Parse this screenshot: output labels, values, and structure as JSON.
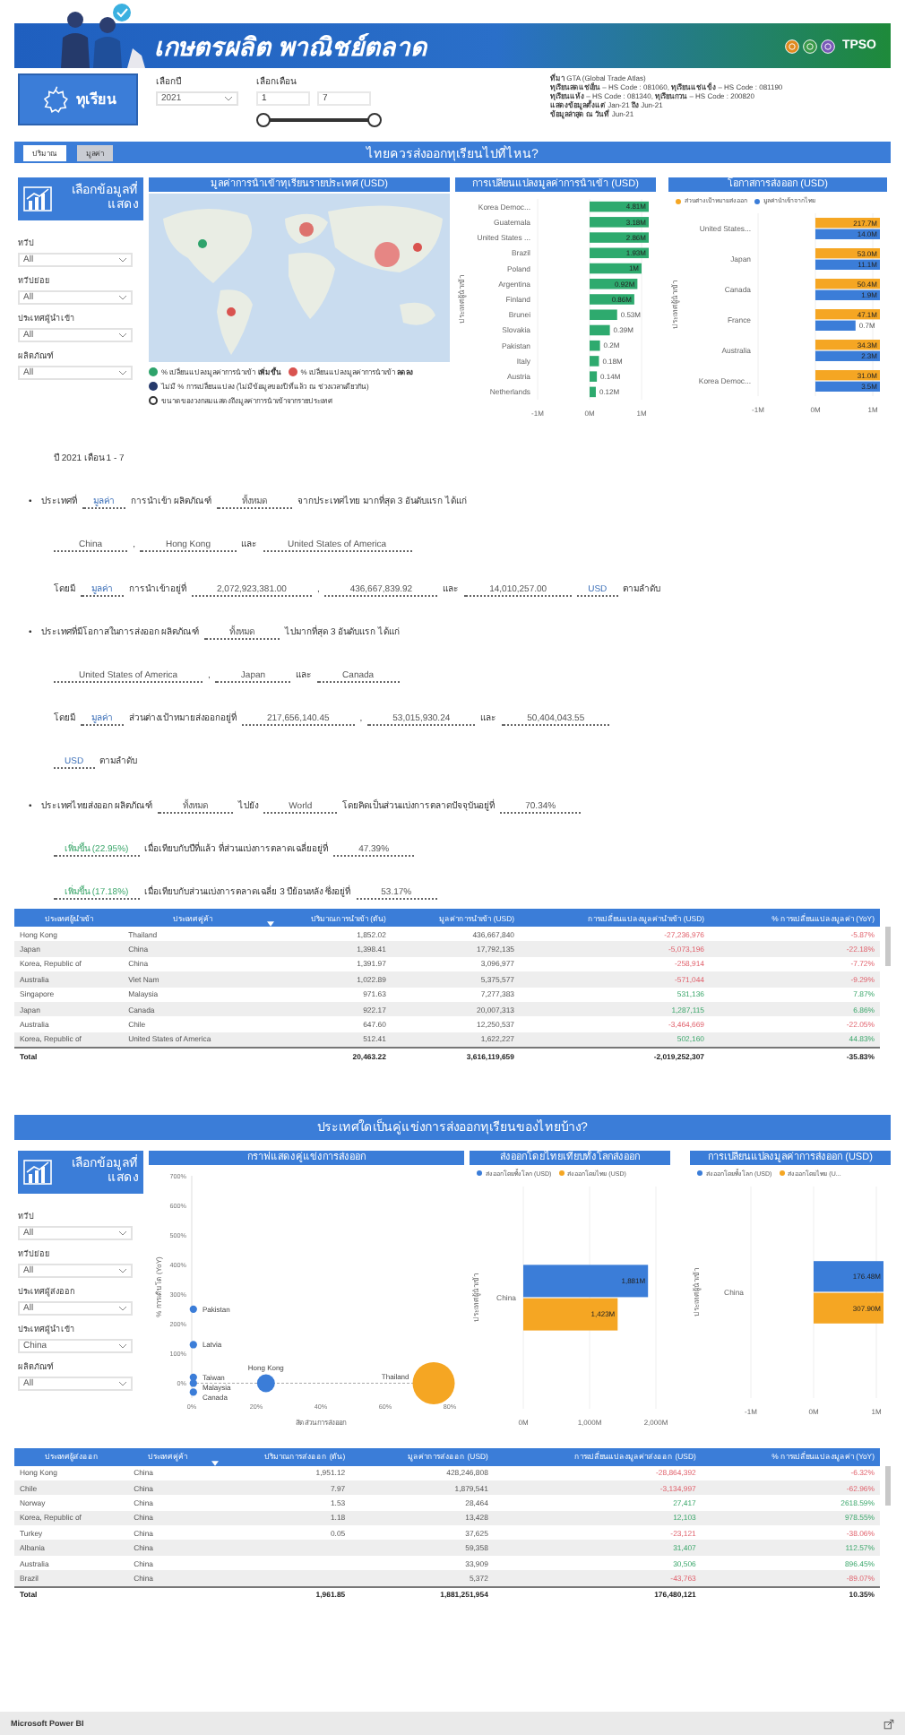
{
  "header": {
    "title": "เกษตรผลิต พาณิชย์ตลาด",
    "brand": "TPSO"
  },
  "product": {
    "label": "ทุเรียน"
  },
  "year_filter": {
    "label": "เลือกปี",
    "value": "2021"
  },
  "month_filter": {
    "label": "เลือกเดือน",
    "from": "1",
    "to": "7",
    "thumbs": [
      {
        "level": 0
      },
      {
        "level": 1
      }
    ]
  },
  "source_notes": [
    "**ที่มา** GTA (Global Trade Atlas)",
    "**ทุเรียนสดแช่เย็น** – HS Code : 081060, **ทุเรียนแช่แข็ง** – HS Code : 081190",
    "**ทุเรียนแห้ง** – HS Code : 081340, **ทุเรียนกวน** – HS Code : 200820",
    "**แสดงข้อมูลตั้งแต่** Jan-21 **ถึง** Jun-21",
    "**ข้อมูลล่าสุด ณ วันที่** Jun-21"
  ],
  "import_section": {
    "toggle": [
      {
        "label": "ปริมาณ",
        "selected": false
      },
      {
        "label": "มูลค่า",
        "selected": true
      }
    ],
    "title": "ไทยควรส่งออกทุเรียนไปที่ไหน?",
    "panel_title": "เลือกข้อมูลที่แสดง",
    "slicers": [
      {
        "label": "ทวีป",
        "value": "All"
      },
      {
        "label": "ทวีปย่อย",
        "value": "All"
      },
      {
        "label": "ประเทศผู้นำเข้า",
        "value": "All"
      },
      {
        "label": "ผลิตภัณฑ์",
        "value": "All"
      }
    ],
    "map": {
      "title": "มูลค่าการนำเข้าทุเรียนรายประเทศ (USD)",
      "legend": [
        {
          "kind": "dot",
          "color": "#2ea36b",
          "text": "% เปลี่ยนแปลงมูลค่าการนำเข้า **เพิ่มขึ้น**"
        },
        {
          "kind": "dot",
          "color": "#d9534f",
          "text": "% เปลี่ยนแปลงมูลค่าการนำเข้า **ลดลง**"
        },
        {
          "kind": "dot",
          "color": "#263a6b",
          "text": "ไม่มี % การเปลี่ยนแปลง (ไม่มีข้อมูลของปีที่แล้ว ณ ช่วงเวลาเดียวกัน)"
        },
        {
          "kind": "ring",
          "text": "ขนาดของวงกลมแสดงถึงมูลค่าการนำเข้าจากรายประเทศ"
        }
      ]
    },
    "change_chart": {
      "title": "การเปลี่ยนแปลงมูลค่าการนำเข้า (USD)",
      "chart_data": {
        "type": "bar",
        "orientation": "horizontal",
        "ylabel": "ประเทศผู้นำเข้า",
        "grid": true,
        "categories": [
          "Korea Democ...",
          "Guatemala",
          "United States ...",
          "Brazil",
          "Poland",
          "Argentina",
          "Finland",
          "Brunei",
          "Slovakia",
          "Pakistan",
          "Italy",
          "Austria",
          "Netherlands"
        ],
        "series": [
          {
            "color": "#2eaa6e",
            "values": [
              null,
              null,
              null,
              null,
              1,
              0.92,
              0.86,
              0.53,
              0.39,
              0.2,
              0.18,
              0.14,
              0.12
            ]
          }
        ],
        "value_labels": [
          [
            "4.81M",
            "3.18M",
            "2.86M",
            "1.93M",
            "1M",
            "0.92M",
            "0.86M",
            "0.53M",
            "0.39M",
            "0.2M",
            "0.18M",
            "0.14M",
            "0.12M"
          ]
        ],
        "xlim": [
          -1,
          1
        ],
        "xticks": [
          {
            "value": -1,
            "label": "-1M"
          },
          {
            "value": 0,
            "label": "0M"
          },
          {
            "value": 1,
            "label": "1M"
          }
        ]
      }
    },
    "opportunity_chart": {
      "title": "โอกาสการส่งออก (USD)",
      "chart_data": {
        "type": "bar",
        "orientation": "horizontal",
        "ylabel": "ประเทศผู้นำเข้า",
        "grid": true,
        "categories": [
          "United States...",
          "Japan",
          "Canada",
          "France",
          "Australia",
          "Korea Democ..."
        ],
        "series": [
          {
            "name": "ส่วนต่างเป้าหมายส่งออก",
            "color": "#f5a623",
            "values": [
              null,
              null,
              null,
              null,
              null,
              null
            ]
          },
          {
            "name": "มูลค่านำเข้าจากไทย",
            "color": "#3b7dd8",
            "values": [
              null,
              null,
              null,
              0.7,
              null,
              null
            ]
          }
        ],
        "value_labels": [
          [
            "217.7M",
            "53.0M",
            "50.4M",
            "47.1M",
            "34.3M",
            "31.0M"
          ],
          [
            "14.0M",
            "11.1M",
            "1.9M",
            "0.7M",
            "2.3M",
            "3.5M"
          ]
        ],
        "xlim": [
          -1,
          1
        ],
        "xticks": [
          {
            "value": -1,
            "label": "-1M"
          },
          {
            "value": 0,
            "label": "0M"
          },
          {
            "value": 1,
            "label": "1M"
          }
        ]
      }
    }
  },
  "summary": {
    "lines": [
      {
        "segments": [
          {
            "kind": "text",
            "text": "ปี 2021 เดือน 1 - 7"
          }
        ]
      },
      {
        "marker": "•",
        "segments": [
          {
            "kind": "text",
            "text": "ประเทศที่"
          },
          {
            "kind": "measure",
            "text": "มูลค่า"
          },
          {
            "kind": "text",
            "text": "การนำเข้า ผลิตภัณฑ์"
          },
          {
            "kind": "blank",
            "text": "ทั้งหมด"
          },
          {
            "kind": "text",
            "text": "จากประเทศไทย มากที่สุด 3 อันดับแรก ได้แก่"
          }
        ]
      },
      {
        "segments": [
          {
            "kind": "blank",
            "text": "China"
          },
          {
            "kind": "text",
            "text": ","
          },
          {
            "kind": "blank",
            "text": "Hong Kong"
          },
          {
            "kind": "text",
            "text": "และ"
          },
          {
            "kind": "blank",
            "text": "United States of America"
          }
        ]
      },
      {
        "segments": [
          {
            "kind": "text",
            "text": "โดยมี"
          },
          {
            "kind": "measure",
            "text": "มูลค่า"
          },
          {
            "kind": "text",
            "text": "การนำเข้าอยู่ที่"
          },
          {
            "kind": "blank",
            "text": "2,072,923,381.00"
          },
          {
            "kind": "text",
            "text": ","
          },
          {
            "kind": "blank",
            "text": "436,667,839.92"
          },
          {
            "kind": "text",
            "text": "และ"
          },
          {
            "kind": "blank",
            "text": "14,010,257.00"
          },
          {
            "kind": "measure",
            "text": "USD"
          },
          {
            "kind": "text",
            "text": "ตามลำดับ"
          }
        ]
      },
      {
        "marker": "•",
        "segments": [
          {
            "kind": "text",
            "text": "ประเทศที่มีโอกาสในการส่งออก ผลิตภัณฑ์"
          },
          {
            "kind": "blank",
            "text": "ทั้งหมด"
          },
          {
            "kind": "text",
            "text": "ไปมากที่สุด 3 อันดับแรก ได้แก่"
          }
        ]
      },
      {
        "segments": [
          {
            "kind": "blank",
            "text": "United States of America"
          },
          {
            "kind": "text",
            "text": ","
          },
          {
            "kind": "blank",
            "text": "Japan"
          },
          {
            "kind": "text",
            "text": "และ"
          },
          {
            "kind": "blank",
            "text": "Canada"
          }
        ]
      },
      {
        "segments": [
          {
            "kind": "text",
            "text": "โดยมี"
          },
          {
            "kind": "measure",
            "text": "มูลค่า"
          },
          {
            "kind": "text",
            "text": "ส่วนต่างเป้าหมายส่งออกอยู่ที่"
          },
          {
            "kind": "blank",
            "text": "217,656,140.45"
          },
          {
            "kind": "text",
            "text": ","
          },
          {
            "kind": "blank",
            "text": "53,015,930.24"
          },
          {
            "kind": "text",
            "text": "และ"
          },
          {
            "kind": "blank",
            "text": "50,404,043.55"
          }
        ]
      },
      {
        "segments": [
          {
            "kind": "measure",
            "text": "USD"
          },
          {
            "kind": "text",
            "text": "ตามลำดับ"
          }
        ]
      },
      {
        "marker": "•",
        "segments": [
          {
            "kind": "text",
            "text": "ประเทศไทยส่งออก ผลิตภัณฑ์"
          },
          {
            "kind": "blank",
            "text": "ทั้งหมด"
          },
          {
            "kind": "text",
            "text": "ไปยัง"
          },
          {
            "kind": "blank",
            "text": "World"
          },
          {
            "kind": "text",
            "text": "โดยคิดเป็นส่วนแบ่งการตลาดปัจจุบันอยู่ที่"
          },
          {
            "kind": "blank",
            "text": "70.34%"
          }
        ]
      },
      {
        "segments": [
          {
            "kind": "increase",
            "text": "เพิ่มขึ้น (22.95%)"
          },
          {
            "kind": "text",
            "text": "เมื่อเทียบกับปีที่แล้ว ที่ส่วนแบ่งการตลาดเฉลี่ยอยู่ที่"
          },
          {
            "kind": "blank",
            "text": "47.39%"
          }
        ]
      },
      {
        "segments": [
          {
            "kind": "increase",
            "text": "เพิ่มขึ้น (17.18%)"
          },
          {
            "kind": "text",
            "text": "เมื่อเทียบกับส่วนแบ่งการตลาดเฉลี่ย 3 ปีย้อนหลัง ซึ่งอยู่ที่"
          },
          {
            "kind": "blank",
            "text": "53.17%"
          }
        ]
      }
    ]
  },
  "import_table": {
    "columns": [
      {
        "label": "ประเทศผู้นำเข้า",
        "sorted": false
      },
      {
        "label": "ประเทศคู่ค้า",
        "sorted": false
      },
      {
        "label": "ปริมาณการนำเข้า (ตัน)",
        "sorted": true
      },
      {
        "label": "มูลค่าการนำเข้า (USD)",
        "sorted": false
      },
      {
        "label": "การเปลี่ยนแปลงมูลค่านำเข้า (USD)",
        "sorted": false
      },
      {
        "label": "% การเปลี่ยนแปลงมูลค่า (YoY)",
        "sorted": false
      }
    ],
    "rows": [
      {
        "country": "Hong Kong",
        "partner": "Thailand",
        "quantity": "1,852.02",
        "value": "436,667,840",
        "change": "-27,236,976",
        "change_pct": "-5.87%",
        "kind": "decrease"
      },
      {
        "country": "Japan",
        "partner": "China",
        "quantity": "1,398.41",
        "value": "17,792,135",
        "change": "-5,073,196",
        "change_pct": "-22.18%",
        "kind": "decrease"
      },
      {
        "country": "Korea, Republic of",
        "partner": "China",
        "quantity": "1,391.97",
        "value": "3,096,977",
        "change": "-258,914",
        "change_pct": "-7.72%",
        "kind": "decrease"
      },
      {
        "country": "Australia",
        "partner": "Viet Nam",
        "quantity": "1,022.89",
        "value": "5,375,577",
        "change": "-571,044",
        "change_pct": "-9.29%",
        "kind": "decrease"
      },
      {
        "country": "Singapore",
        "partner": "Malaysia",
        "quantity": "971.63",
        "value": "7,277,383",
        "change": "531,136",
        "change_pct": "7.87%",
        "kind": "increase"
      },
      {
        "country": "Japan",
        "partner": "Canada",
        "quantity": "922.17",
        "value": "20,007,313",
        "change": "1,287,115",
        "change_pct": "6.86%",
        "kind": "increase"
      },
      {
        "country": "Australia",
        "partner": "Chile",
        "quantity": "647.60",
        "value": "12,250,537",
        "change": "-3,464,669",
        "change_pct": "-22.05%",
        "kind": "decrease"
      },
      {
        "country": "Korea, Republic of",
        "partner": "United States of America",
        "quantity": "512.41",
        "value": "1,622,227",
        "change": "502,160",
        "change_pct": "44.83%",
        "kind": "increase"
      }
    ],
    "total": {
      "label": "Total",
      "quantity": "20,463.22",
      "value": "3,616,119,659",
      "change": "-2,019,252,307",
      "change_pct": "-35.83%"
    }
  },
  "competitor_section": {
    "title": "ประเทศใดเป็นคู่แข่งการส่งออกทุเรียนของไทยบ้าง?",
    "panel_title": "เลือกข้อมูลที่แสดง",
    "slicers": [
      {
        "label": "ทวีป",
        "value": "All"
      },
      {
        "label": "ทวีปย่อย",
        "value": "All"
      },
      {
        "label": "ประเทศผู้ส่งออก",
        "value": "All"
      },
      {
        "label": "ประเทศผู้นำเข้า",
        "value": "China"
      },
      {
        "label": "ผลิตภัณฑ์",
        "value": "All"
      }
    ],
    "scatter": {
      "title": "กราฟแสดงคู่แข่งการส่งออก",
      "chart_data": {
        "type": "scatter",
        "xlabel": "สัดส่วนการส่งออก",
        "ylabel": "% การเติบโต (YoY)",
        "x": [
          0.5,
          0.5,
          0.5,
          0.5,
          0.5,
          23,
          75
        ],
        "series": [
          {
            "name": "Pakistan",
            "color": "#3b7dd8",
            "values": [
              250,
              null,
              null,
              null,
              null,
              null,
              null
            ]
          },
          {
            "name": "Latvia",
            "color": "#3b7dd8",
            "values": [
              null,
              130,
              null,
              null,
              null,
              null,
              null
            ]
          },
          {
            "name": "Taiwan",
            "color": "#3b7dd8",
            "values": [
              null,
              null,
              20,
              null,
              null,
              null,
              null
            ]
          },
          {
            "name": "Malaysia",
            "color": "#3b7dd8",
            "values": [
              null,
              null,
              null,
              0,
              null,
              null,
              null
            ]
          },
          {
            "name": "Canada",
            "color": "#3b7dd8",
            "values": [
              null,
              null,
              null,
              null,
              -30,
              null,
              null
            ]
          },
          {
            "name": "Hong Kong",
            "color": "#3b7dd8",
            "values": [
              null,
              null,
              null,
              null,
              null,
              0,
              null
            ]
          },
          {
            "name": "Thailand",
            "color": "#f5a623",
            "values": [
              null,
              null,
              null,
              null,
              null,
              null,
              0
            ]
          }
        ],
        "xlim": [
          0,
          80
        ],
        "ylim": [
          -50,
          700
        ],
        "xticks": [
          {
            "value": 0,
            "label": "0%"
          },
          {
            "value": 20,
            "label": "20%"
          },
          {
            "value": 40,
            "label": "40%"
          },
          {
            "value": 60,
            "label": "60%"
          },
          {
            "value": 80,
            "label": "80%"
          }
        ],
        "yticks": [
          {
            "value": 0,
            "label": "0%"
          },
          {
            "value": 100,
            "label": "100%"
          },
          {
            "value": 200,
            "label": "200%"
          },
          {
            "value": 300,
            "label": "300%"
          },
          {
            "value": 400,
            "label": "400%"
          },
          {
            "value": 500,
            "label": "500%"
          },
          {
            "value": 600,
            "label": "600%"
          },
          {
            "value": 700,
            "label": "700%"
          }
        ]
      }
    },
    "share_chart": {
      "title": "ส่งออกโดยไทยเทียบทั้งโลกส่งออก",
      "chart_data": {
        "type": "bar",
        "orientation": "horizontal",
        "ylabel": "ประเทศผู้นำเข้า",
        "grid": true,
        "categories": [
          "China"
        ],
        "series": [
          {
            "name": "ส่งออกโดยทั้งโลก (USD)",
            "color": "#3b7dd8",
            "values": [
              1881
            ]
          },
          {
            "name": "ส่งออกโดยไทย (USD)",
            "color": "#f5a623",
            "values": [
              1423
            ]
          }
        ],
        "value_labels": [
          [
            "1,881M"
          ],
          [
            "1,423M"
          ]
        ],
        "xlim": [
          0,
          2000
        ],
        "xticks": [
          {
            "value": 0,
            "label": "0M"
          },
          {
            "value": 1000,
            "label": "1,000M"
          },
          {
            "value": 2000,
            "label": "2,000M"
          }
        ]
      }
    },
    "export_change_chart": {
      "title": "การเปลี่ยนแปลงมูลค่าการส่งออก (USD)",
      "chart_data": {
        "type": "bar",
        "orientation": "horizontal",
        "ylabel": "ประเทศผู้นำเข้า",
        "grid": true,
        "categories": [
          "China"
        ],
        "series": [
          {
            "name": "ส่งออกโดยทั้งโลก (USD)",
            "color": "#3b7dd8",
            "values": [
              null
            ]
          },
          {
            "name": "ส่งออกโดยไทย (U...",
            "color": "#f5a623",
            "values": [
              null
            ]
          }
        ],
        "value_labels": [
          [
            "176.48M"
          ],
          [
            "307.90M"
          ]
        ],
        "xlim": [
          -1,
          1
        ],
        "xticks": [
          {
            "value": -1,
            "label": "-1M"
          },
          {
            "value": 0,
            "label": "0M"
          },
          {
            "value": 1,
            "label": "1M"
          }
        ]
      }
    }
  },
  "export_table": {
    "columns": [
      {
        "label": "ประเทศผู้ส่งออก",
        "sorted": false
      },
      {
        "label": "ประเทศคู่ค้า",
        "sorted": false
      },
      {
        "label": "ปริมาณการส่งออก (ตัน)",
        "sorted": true
      },
      {
        "label": "มูลค่าการส่งออก (USD)",
        "sorted": false
      },
      {
        "label": "การเปลี่ยนแปลงมูลค่าส่งออก (USD)",
        "sorted": false
      },
      {
        "label": "% การเปลี่ยนแปลงมูลค่า (YoY)",
        "sorted": false
      }
    ],
    "rows": [
      {
        "country": "Hong Kong",
        "partner": "China",
        "quantity": "1,951.12",
        "value": "428,246,808",
        "change": "-28,864,392",
        "change_pct": "-6.32%",
        "kind": "decrease"
      },
      {
        "country": "Chile",
        "partner": "China",
        "quantity": "7.97",
        "value": "1,879,541",
        "change": "-3,134,997",
        "change_pct": "-62.96%",
        "kind": "decrease"
      },
      {
        "country": "Norway",
        "partner": "China",
        "quantity": "1.53",
        "value": "28,464",
        "change": "27,417",
        "change_pct": "2618.59%",
        "kind": "increase"
      },
      {
        "country": "Korea, Republic of",
        "partner": "China",
        "quantity": "1.18",
        "value": "13,428",
        "change": "12,103",
        "change_pct": "978.55%",
        "kind": "increase"
      },
      {
        "country": "Turkey",
        "partner": "China",
        "quantity": "0.05",
        "value": "37,625",
        "change": "-23,121",
        "change_pct": "-38.06%",
        "kind": "decrease"
      },
      {
        "country": "Albania",
        "partner": "China",
        "value": "59,358",
        "change": "31,407",
        "change_pct": "112.57%",
        "kind": "increase"
      },
      {
        "country": "Australia",
        "partner": "China",
        "value": "33,909",
        "change": "30,506",
        "change_pct": "896.45%",
        "kind": "increase"
      },
      {
        "country": "Brazil",
        "partner": "China",
        "value": "5,372",
        "change": "-43,763",
        "change_pct": "-89.07%",
        "kind": "decrease"
      }
    ],
    "total": {
      "label": "Total",
      "quantity": "1,961.85",
      "value": "1,881,251,954",
      "change": "176,480,121",
      "change_pct": "10.35%"
    }
  },
  "status_bar": {
    "text": "Microsoft Power BI"
  }
}
